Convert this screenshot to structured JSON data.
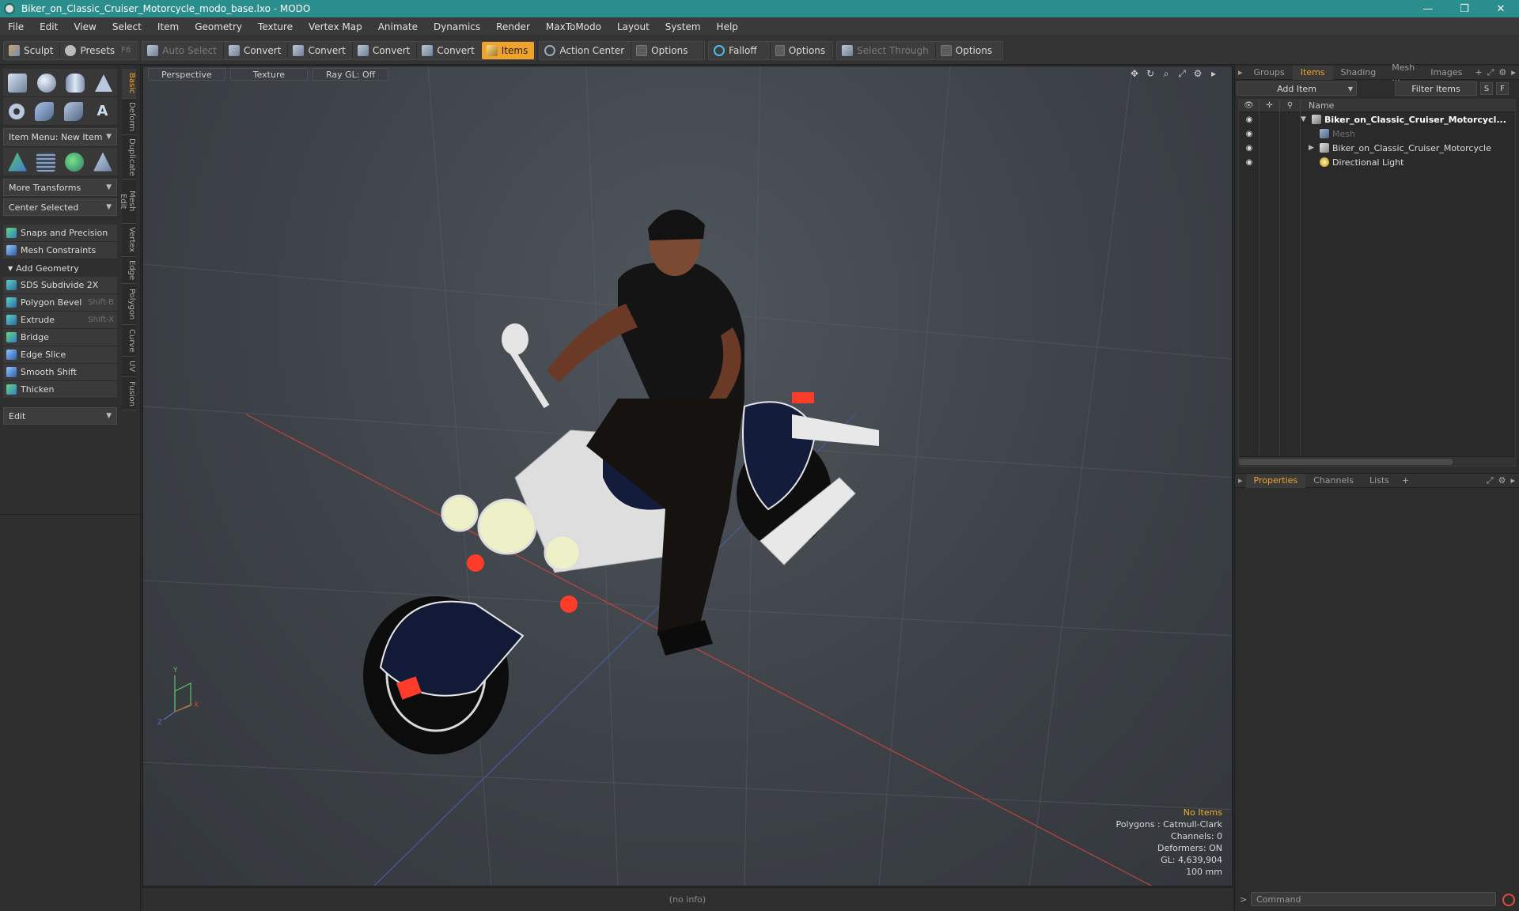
{
  "window": {
    "title": "Biker_on_Classic_Cruiser_Motorcycle_modo_base.lxo - MODO",
    "minimize": "—",
    "restore": "❐",
    "close": "✕"
  },
  "menu": [
    "File",
    "Edit",
    "View",
    "Select",
    "Item",
    "Geometry",
    "Texture",
    "Vertex Map",
    "Animate",
    "Dynamics",
    "Render",
    "MaxToModo",
    "Layout",
    "System",
    "Help"
  ],
  "toolbar": {
    "sculpt": "Sculpt",
    "presets": "Presets",
    "presets_key": "F6",
    "auto_select": "Auto Select",
    "convert_1": "Convert",
    "convert_2": "Convert",
    "convert_3": "Convert",
    "convert_4": "Convert",
    "items": "Items",
    "action_center": "Action Center",
    "options_1": "Options",
    "falloff": "Falloff",
    "options_2": "Options",
    "select_through": "Select Through",
    "options_3": "Options"
  },
  "left_panel": {
    "item_menu": "Item Menu: New Item",
    "more_transforms": "More Transforms",
    "center_selected": "Center Selected",
    "snaps_and_precision": "Snaps and Precision",
    "mesh_constraints": "Mesh Constraints",
    "add_geometry": "Add Geometry",
    "tools": [
      {
        "label": "SDS Subdivide 2X",
        "key": ""
      },
      {
        "label": "Polygon Bevel",
        "key": "Shift-B"
      },
      {
        "label": "Extrude",
        "key": "Shift-X"
      },
      {
        "label": "Bridge",
        "key": ""
      },
      {
        "label": "Edge Slice",
        "key": ""
      },
      {
        "label": "Smooth Shift",
        "key": ""
      },
      {
        "label": "Thicken",
        "key": ""
      }
    ],
    "edit_dropdown": "Edit",
    "side_tabs": [
      "Basic",
      "Deform",
      "Duplicate",
      "Mesh Edit",
      "Vertex",
      "Edge",
      "Polygon",
      "Curve",
      "UV",
      "Fusion"
    ]
  },
  "viewport": {
    "view_mode": "Perspective",
    "shading": "Texture",
    "raygl": "Ray GL: Off",
    "info": {
      "selection": "No Items",
      "polygons": "Polygons : Catmull-Clark",
      "channels": "Channels: 0",
      "deformers": "Deformers: ON",
      "gl": "GL: 4,639,904",
      "scale": "100 mm"
    },
    "axis_x": "X",
    "axis_y": "Y",
    "axis_z": "Z"
  },
  "items_panel": {
    "tabs": [
      "Groups",
      "Items",
      "Shading",
      "Mesh ...",
      "Images"
    ],
    "active_tab": "Items",
    "add_item": "Add Item",
    "filter_items": "Filter Items",
    "filter_s": "S",
    "filter_f": "F",
    "column_name": "Name",
    "rows": [
      {
        "label": "Biker_on_Classic_Cruiser_Motorcycl...",
        "style": "bold",
        "arrow": "▼"
      },
      {
        "label": "Mesh",
        "style": "dim",
        "arrow": ""
      },
      {
        "label": "Biker_on_Classic_Cruiser_Motorcycle",
        "style": "normal",
        "arrow": "▶"
      },
      {
        "label": "Directional Light",
        "style": "normal",
        "arrow": ""
      }
    ]
  },
  "properties_panel": {
    "tabs": [
      "Properties",
      "Channels",
      "Lists"
    ],
    "active_tab": "Properties",
    "command_placeholder": "Command"
  },
  "status": {
    "info": "(no info)"
  },
  "colors": {
    "accent": "#f0a32a",
    "titlebar": "#2a8f8c",
    "grid_red": "#c0443a",
    "grid_blue": "#4a5a9e"
  }
}
